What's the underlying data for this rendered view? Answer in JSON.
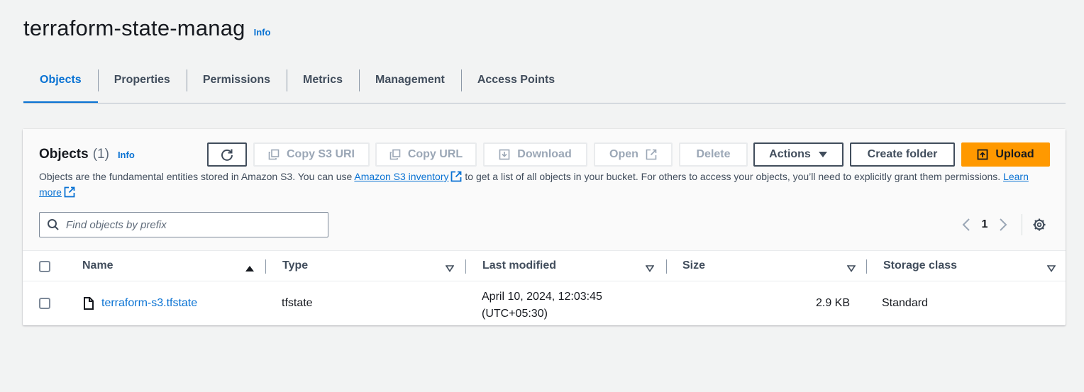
{
  "page": {
    "title": "terraform-state-manag",
    "info_label": "Info"
  },
  "tabs": [
    {
      "label": "Objects",
      "active": true
    },
    {
      "label": "Properties",
      "active": false
    },
    {
      "label": "Permissions",
      "active": false
    },
    {
      "label": "Metrics",
      "active": false
    },
    {
      "label": "Management",
      "active": false
    },
    {
      "label": "Access Points",
      "active": false
    }
  ],
  "objects_panel": {
    "title": "Objects",
    "count": "(1)",
    "info_label": "Info",
    "buttons": {
      "refresh": {
        "icon": "refresh-icon"
      },
      "copy_s3_uri": {
        "label": "Copy S3 URI",
        "icon": "copy-icon",
        "disabled": true
      },
      "copy_url": {
        "label": "Copy URL",
        "icon": "copy-icon",
        "disabled": true
      },
      "download": {
        "label": "Download",
        "icon": "download-icon",
        "disabled": true
      },
      "open": {
        "label": "Open",
        "icon": "external-link-icon",
        "disabled": true
      },
      "delete": {
        "label": "Delete",
        "disabled": true
      },
      "actions": {
        "label": "Actions",
        "icon": "caret-down-icon"
      },
      "create_folder": {
        "label": "Create folder"
      },
      "upload": {
        "label": "Upload",
        "icon": "upload-icon"
      }
    },
    "description": {
      "text_before": "Objects are the fundamental entities stored in Amazon S3. You can use ",
      "inventory_link": "Amazon S3 inventory",
      "text_after": " to get a list of all objects in your bucket. For others to access your objects, you’ll need to explicitly grant them permissions. ",
      "learn_more_link": "Learn more"
    },
    "search": {
      "placeholder": "Find objects by prefix"
    },
    "pagination": {
      "current_page": "1"
    },
    "columns": [
      {
        "label": "Name",
        "sort": "ascending"
      },
      {
        "label": "Type",
        "sort": "none"
      },
      {
        "label": "Last modified",
        "sort": "none"
      },
      {
        "label": "Size",
        "sort": "none"
      },
      {
        "label": "Storage class",
        "sort": "none"
      }
    ],
    "rows": [
      {
        "name": "terraform-s3.tfstate",
        "type": "tfstate",
        "last_modified_line1": "April 10, 2024, 12:03:45",
        "last_modified_line2": "(UTC+05:30)",
        "size": "2.9 KB",
        "storage_class": "Standard",
        "checked": false
      }
    ]
  },
  "colors": {
    "accent": "#0972d3",
    "primary_button": "#ff9900",
    "background": "#f2f3f3",
    "text": "#16191f",
    "disabled": "#9ba7b6"
  }
}
